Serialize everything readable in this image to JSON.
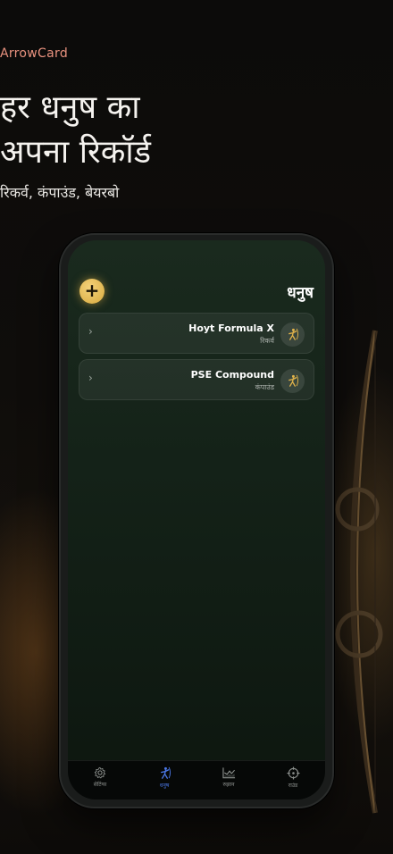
{
  "app_name": "ArrowCard",
  "headline": {
    "line1": "हर धनुष का",
    "line2": "अपना रिकॉर्ड"
  },
  "subline": "रिकर्व, कंपाउंड, बेयरबो",
  "screen": {
    "title": "धनुष",
    "add_label": "+",
    "bows": [
      {
        "name": "Hoyt Formula X",
        "type": "रिकर्व",
        "chevron": "›",
        "icon": "archer-icon"
      },
      {
        "name": "PSE Compound",
        "type": "कंपाउंड",
        "chevron": "›",
        "icon": "archer-icon"
      }
    ]
  },
  "tabs": [
    {
      "label": "सेटिंग्स",
      "icon": "gear-icon",
      "active": false
    },
    {
      "label": "धनुष",
      "icon": "archer-icon",
      "active": true
    },
    {
      "label": "रुझान",
      "icon": "trend-chart-icon",
      "active": false
    },
    {
      "label": "राउंड",
      "icon": "target-icon",
      "active": false
    }
  ],
  "colors": {
    "accent_gold": "#e0b24a",
    "app_name_color": "#e9927f",
    "active_tab": "#4b78e6"
  }
}
